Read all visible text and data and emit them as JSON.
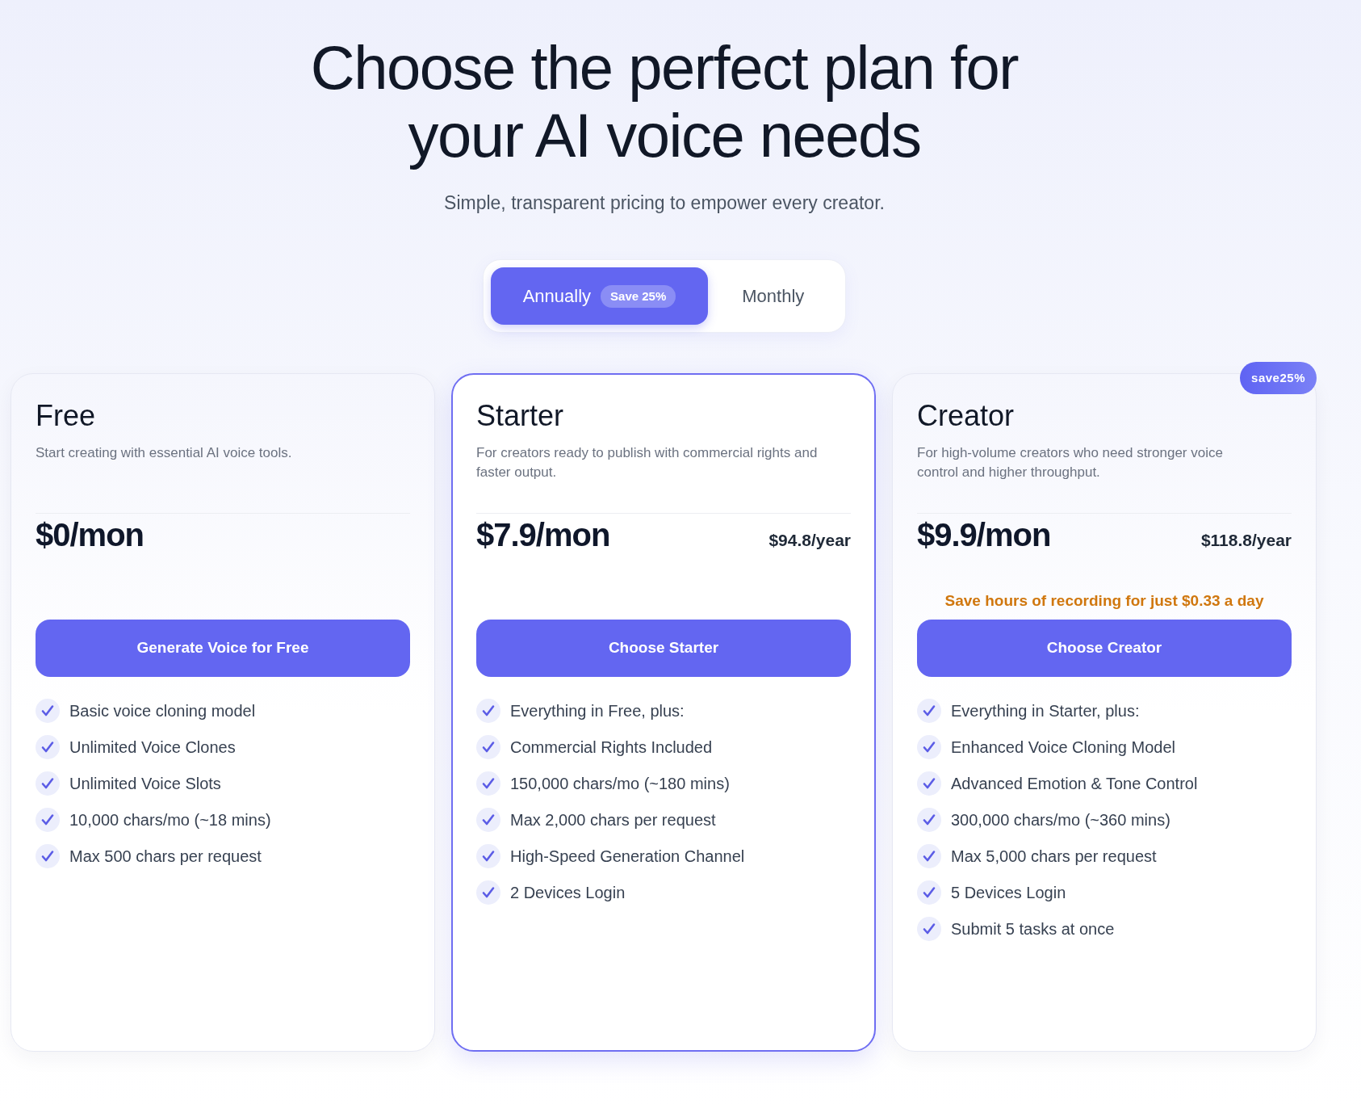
{
  "header": {
    "title": "Choose the perfect plan for your AI voice needs",
    "subtitle": "Simple, transparent pricing to empower every creator."
  },
  "billing_toggle": [
    {
      "label": "Annually",
      "selected": true,
      "badge": "Save 25%"
    },
    {
      "label": "Monthly",
      "selected": false
    }
  ],
  "plans": [
    {
      "name": "Free",
      "highlighted": false,
      "description": "Start creating with essential AI voice tools.",
      "price": "$0/mon",
      "button": "Generate Voice for Free",
      "features": [
        "Basic voice cloning model",
        "Unlimited Voice Clones",
        "Unlimited Voice Slots",
        "10,000 chars/mo (~18 mins)",
        "Max 500 chars per request"
      ]
    },
    {
      "name": "Starter",
      "highlighted": true,
      "description": "For creators ready to publish with commercial rights and faster output.",
      "price": "$7.9/mon",
      "yearly_price": "$94.8/year",
      "button": "Choose Starter",
      "features": [
        "Everything in Free, plus:",
        "Commercial Rights Included",
        "150,000 chars/mo (~180 mins)",
        "Max 2,000 chars per request",
        "High-Speed Generation Channel",
        "2 Devices Login"
      ]
    },
    {
      "name": "Creator",
      "highlighted": false,
      "badge": "save25%",
      "description": "For high-volume creators who need stronger voice control and higher throughput.",
      "price": "$9.9/mon",
      "yearly_price": "$118.8/year",
      "promo": "Save hours of recording for just $0.33 a day",
      "button": "Choose Creator",
      "features": [
        "Everything in Starter, plus:",
        "Enhanced Voice Cloning Model",
        "Advanced Emotion & Tone Control",
        "300,000 chars/mo (~360 mins)",
        "Max 5,000 chars per request",
        "5 Devices Login",
        "Submit 5 tasks at once"
      ]
    }
  ]
}
